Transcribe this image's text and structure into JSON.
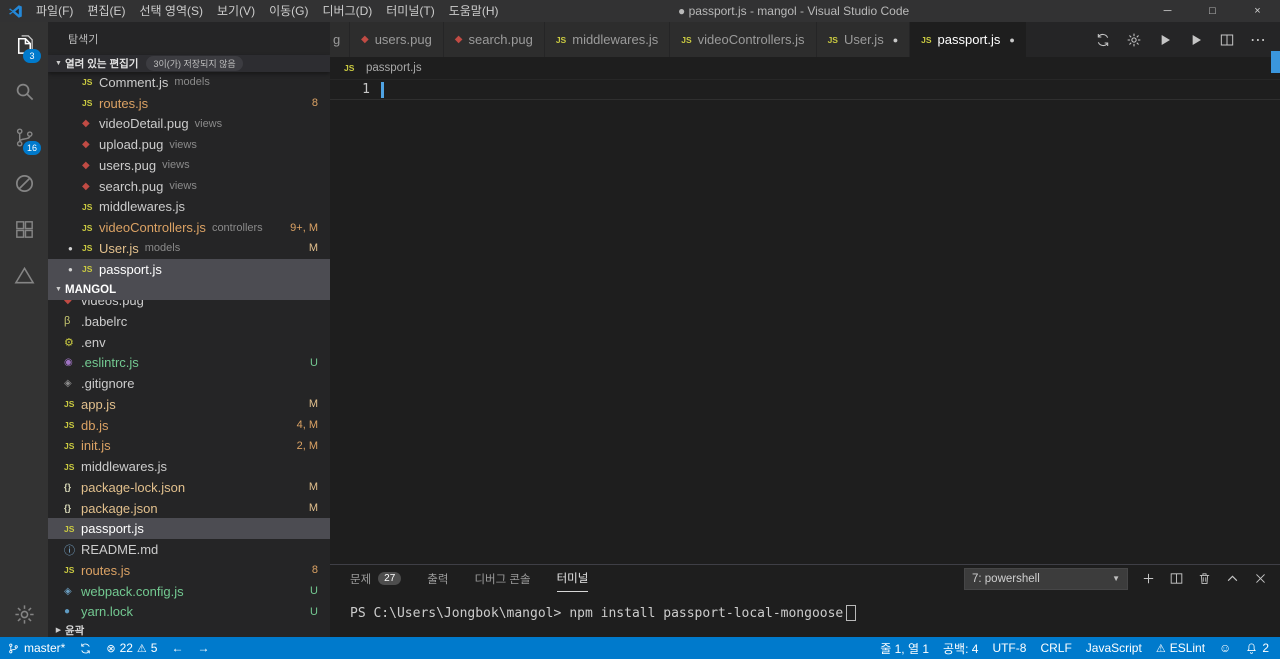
{
  "colors": {
    "accent": "#007acc",
    "modified": "#e2c08d",
    "untracked": "#73c991",
    "problem": "#dba264",
    "statusbar": "#007acc"
  },
  "icons": {
    "js": "JS",
    "pug": "◆",
    "babel": "β",
    "env": "⚙",
    "eslint": "◉",
    "git": "◈",
    "json": "{}",
    "info": "ⓘ",
    "webpack": "◈",
    "yarn": "●",
    "dot": "●",
    "chevron_down": "▼",
    "chevron_right": "▶",
    "select_arrow": "▼",
    "error": "⊗",
    "warning": "⚠",
    "smiley": "☺",
    "arrow_left": "←",
    "arrow_right": "→",
    "more": "⋯"
  },
  "title_bar": {
    "menus": [
      "파일(F)",
      "편집(E)",
      "선택 영역(S)",
      "보기(V)",
      "이동(G)",
      "디버그(D)",
      "터미널(T)",
      "도움말(H)"
    ],
    "title": "● passport.js - mangol - Visual Studio Code",
    "window": {
      "minimize": "─",
      "maximize": "□",
      "close": "×"
    }
  },
  "activity_bar": {
    "explorer_badge": "3",
    "scm_badge": "16"
  },
  "sidebar": {
    "title": "탐색기",
    "open_editors": {
      "label": "열려 있는 편집기",
      "badge": "3이(가) 저장되지 않음",
      "items": [
        {
          "name": "Comment.js",
          "desc": "models"
        },
        {
          "name": "routes.js",
          "badge": "8"
        },
        {
          "name": "videoDetail.pug",
          "desc": "views"
        },
        {
          "name": "upload.pug",
          "desc": "views"
        },
        {
          "name": "users.pug",
          "desc": "views"
        },
        {
          "name": "search.pug",
          "desc": "views"
        },
        {
          "name": "middlewares.js"
        },
        {
          "name": "videoControllers.js",
          "desc": "controllers",
          "badge": "9+, M"
        },
        {
          "name": "User.js",
          "desc": "models",
          "badge": "M"
        },
        {
          "name": "passport.js"
        }
      ]
    },
    "folder": {
      "label": "MANGOL",
      "items": [
        {
          "name": "videos.pug"
        },
        {
          "name": ".babelrc"
        },
        {
          "name": ".env"
        },
        {
          "name": ".eslintrc.js",
          "badge": "U"
        },
        {
          "name": ".gitignore"
        },
        {
          "name": "app.js",
          "badge": "M"
        },
        {
          "name": "db.js",
          "badge": "4, M"
        },
        {
          "name": "init.js",
          "badge": "2, M"
        },
        {
          "name": "middlewares.js"
        },
        {
          "name": "package-lock.json",
          "badge": "M"
        },
        {
          "name": "package.json",
          "badge": "M"
        },
        {
          "name": "passport.js"
        },
        {
          "name": "README.md"
        },
        {
          "name": "routes.js",
          "badge": "8"
        },
        {
          "name": "webpack.config.js",
          "badge": "U"
        },
        {
          "name": "yarn.lock",
          "badge": "U"
        }
      ]
    },
    "outline_label": "윤곽"
  },
  "editor_tabs": {
    "partial": "g",
    "items": [
      {
        "label": "users.pug"
      },
      {
        "label": "search.pug"
      },
      {
        "label": "middlewares.js"
      },
      {
        "label": "videoControllers.js"
      },
      {
        "label": "User.js"
      },
      {
        "label": "passport.js"
      }
    ]
  },
  "breadcrumb": {
    "file": "passport.js"
  },
  "editor": {
    "line_number": "1"
  },
  "panel": {
    "tabs": [
      {
        "label": "문제",
        "badge": "27"
      },
      {
        "label": "출력"
      },
      {
        "label": "디버그 콘솔"
      },
      {
        "label": "터미널"
      }
    ],
    "terminal_select": "7: powershell",
    "terminal": {
      "prompt": "PS C:\\Users\\Jongbok\\mangol>",
      "command": "npm install passport-local-mongoose"
    }
  },
  "status_bar": {
    "left": {
      "branch": "master*",
      "errors": "22",
      "warnings": "5"
    },
    "right": {
      "cursor": "줄 1, 열 1",
      "indent": "공백: 4",
      "encoding": "UTF-8",
      "eol": "CRLF",
      "language": "JavaScript",
      "eslint": "ESLint",
      "notifications": "2"
    }
  }
}
